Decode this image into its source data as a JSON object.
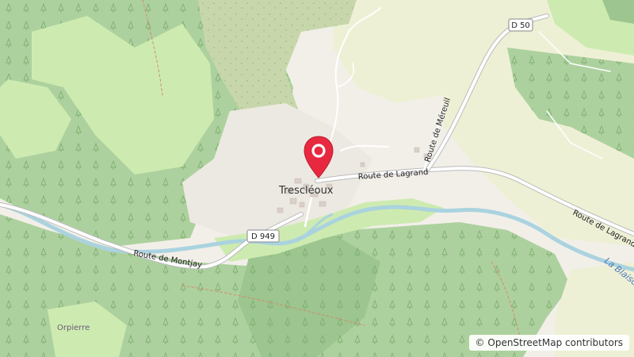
{
  "map": {
    "town": "Trescléoux",
    "area_label": "Orpierre",
    "roads": {
      "route_de_lagrand_1": "Route de Lagrand",
      "route_de_lagrand_2": "Route de Lagrand",
      "route_de_montjay": "Route de Montjay",
      "route_de_mereuil": "Route de Méreuil"
    },
    "shields": {
      "d949": "D 949",
      "d50": "D 50"
    },
    "river": "La Blaisc"
  },
  "attribution": {
    "symbol": "©",
    "text": "OpenStreetMap contributors"
  },
  "colors": {
    "background": "#f2efe9",
    "forest": "#add19e",
    "forest_dark": "#9cc58f",
    "meadow": "#cdebb0",
    "scrub": "#c8d7ab",
    "farmland": "#eef0d5",
    "water": "#aad3df",
    "marker": "#e8283f"
  }
}
